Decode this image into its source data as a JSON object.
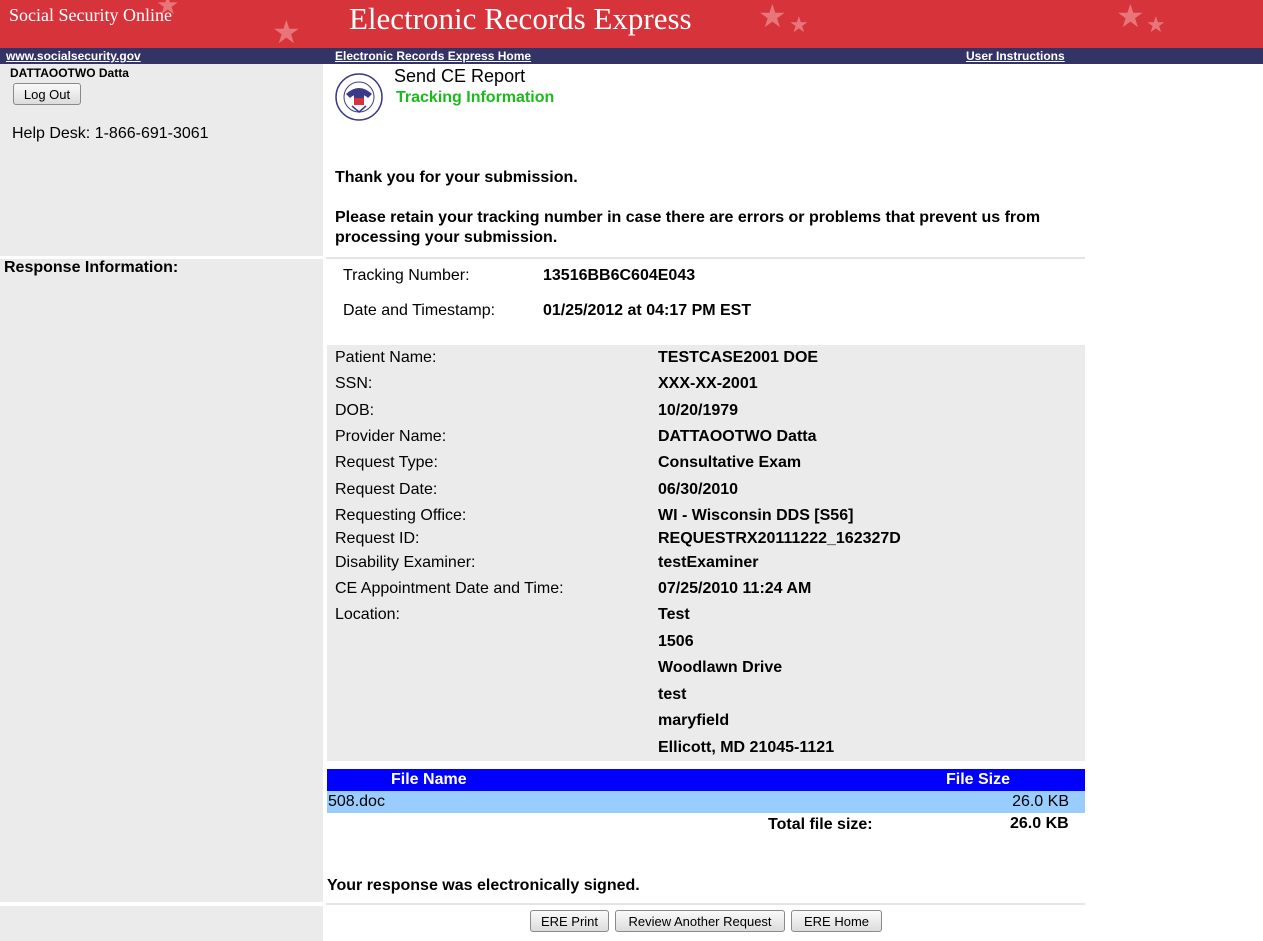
{
  "banner": {
    "ssa_title": "Social Security Online",
    "app_title": "Electronic Records Express"
  },
  "nav": {
    "ssa_link": "www.socialsecurity.gov",
    "home_link": "Electronic Records Express Home",
    "instructions_link": "User Instructions"
  },
  "sidebar": {
    "user_name": "DATTAOOTWO  Datta",
    "logout_label": "Log Out",
    "help_desk": "Help Desk: 1-866-691-3061",
    "response_heading": "Response Information:"
  },
  "header": {
    "title": "Send CE Report",
    "subtitle": "Tracking Information"
  },
  "messages": {
    "thanks": "Thank you for your submission.",
    "retain_line1": "Please retain your tracking number in case there are errors or problems that prevent us from",
    "retain_line2": "processing your submission.",
    "signed": "Your response was electronically signed."
  },
  "tracking": {
    "number_label": "Tracking Number:",
    "number_value": "13516BB6C604E043",
    "timestamp_label": "Date and Timestamp:",
    "timestamp_value": "01/25/2012 at 04:17 PM EST"
  },
  "details": [
    {
      "label": "Patient Name:",
      "value": "TESTCASE2001 DOE"
    },
    {
      "label": "SSN:",
      "value": "XXX-XX-2001"
    },
    {
      "label": "DOB:",
      "value": "10/20/1979"
    },
    {
      "label": "Provider Name:",
      "value": "DATTAOOTWO Datta"
    },
    {
      "label": "Request Type:",
      "value": "Consultative Exam"
    },
    {
      "label": "Request Date:",
      "value": "06/30/2010"
    },
    {
      "label": "Requesting Office:",
      "value": "WI - Wisconsin DDS [S56]"
    },
    {
      "label": "Request ID:",
      "value": "REQUESTRX20111222_162327D"
    },
    {
      "label": "Disability Examiner:",
      "value": "testExaminer"
    },
    {
      "label": "CE Appointment Date and Time:",
      "value": "07/25/2010 11:24 AM"
    },
    {
      "label": "Location:",
      "value": "Test"
    }
  ],
  "location_lines": [
    "1506",
    "Woodlawn Drive",
    "test",
    "maryfield",
    "Ellicott, MD 21045-1121"
  ],
  "files": {
    "col_name": "File Name",
    "col_size": "File Size",
    "rows": [
      {
        "name": "508.doc",
        "size": "26.0 KB"
      }
    ],
    "total_label": "Total file size:",
    "total_value": "26.0 KB"
  },
  "buttons": {
    "print": "ERE Print",
    "review": "Review Another Request",
    "home": "ERE Home"
  },
  "colors": {
    "banner": "#d6333b",
    "navbar": "#333366",
    "subtitle": "#1bbb1b",
    "table_header": "#0000ff",
    "table_row": "#99ccff",
    "panel": "#ebebeb"
  }
}
